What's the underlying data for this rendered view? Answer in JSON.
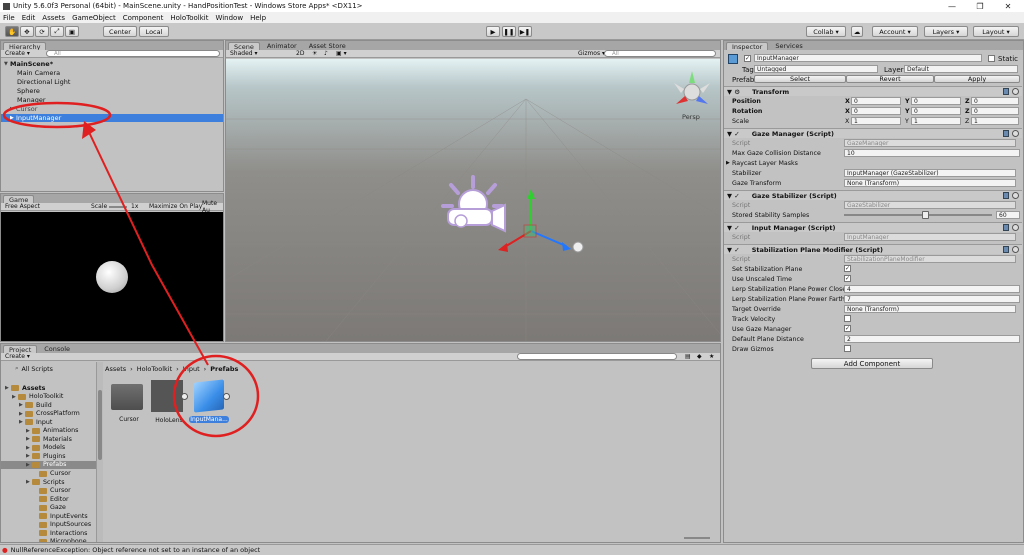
{
  "window": {
    "title": "Unity 5.6.0f3 Personal (64bit) - MainScene.unity - HandPositionTest - Windows Store Apps* <DX11>"
  },
  "menu": [
    "File",
    "Edit",
    "Assets",
    "GameObject",
    "Component",
    "HoloToolkit",
    "Window",
    "Help"
  ],
  "toolbar": {
    "center_label": "Center",
    "local_label": "Local",
    "collab_label": "Collab",
    "account_label": "Account",
    "layers_label": "Layers",
    "layout_label": "Layout"
  },
  "hierarchy": {
    "tab": "Hierarchy",
    "create": "Create",
    "search": "All",
    "scene": "MainScene*",
    "items": [
      "Main Camera",
      "Directional Light",
      "Sphere",
      "Manager",
      "Cursor",
      "InputManager"
    ]
  },
  "scene": {
    "tabs": [
      "Scene",
      "Animator",
      "Asset Store"
    ],
    "shading": "Shaded",
    "mode2d": "2D",
    "gizmos": "Gizmos",
    "search": "All",
    "persp": "Persp"
  },
  "game": {
    "tab": "Game",
    "aspect": "Free Aspect",
    "scale_label": "Scale",
    "scale_value": "1x",
    "maximize": "Maximize On Play",
    "mute": "Mute Au"
  },
  "inspector": {
    "tabs": [
      "Inspector",
      "Services"
    ],
    "object_name": "InputManager",
    "static_label": "Static",
    "tag_label": "Tag",
    "tag_value": "Untagged",
    "layer_label": "Layer",
    "layer_value": "Default",
    "prefab_label": "Prefab",
    "select": "Select",
    "revert": "Revert",
    "apply": "Apply",
    "transform": {
      "title": "Transform",
      "position": "Position",
      "rotation": "Rotation",
      "scale": "Scale",
      "pos": [
        "0",
        "0",
        "0"
      ],
      "rot": [
        "0",
        "0",
        "0"
      ],
      "scl": [
        "1",
        "1",
        "1"
      ],
      "axes": [
        "X",
        "Y",
        "Z"
      ]
    },
    "gaze_manager": {
      "title": "Gaze Manager (Script)",
      "script_label": "Script",
      "script_value": "GazeManager",
      "max_label": "Max Gaze Collision Distance",
      "max_value": "10",
      "raycast_label": "Raycast Layer Masks",
      "stabilizer_label": "Stabilizer",
      "stabilizer_value": "InputManager (GazeStabilizer)",
      "transform_label": "Gaze Transform",
      "transform_value": "None (Transform)"
    },
    "gaze_stabilizer": {
      "title": "Gaze Stabilizer (Script)",
      "script_label": "Script",
      "script_value": "GazeStabilizer",
      "samples_label": "Stored Stability Samples",
      "samples_value": "60",
      "samples_fraction": 0.55
    },
    "input_manager": {
      "title": "Input Manager (Script)",
      "script_label": "Script",
      "script_value": "InputManager"
    },
    "stab_plane": {
      "title": "Stabilization Plane Modifier (Script)",
      "script_label": "Script",
      "script_value": "StabilizationPlaneModifier",
      "set_label": "Set Stabilization Plane",
      "unscaled_label": "Use Unscaled Time",
      "closer_label": "Lerp Stabilization Plane Power Closer",
      "closer_value": "4",
      "farther_label": "Lerp Stabilization Plane Power Farthe",
      "farther_value": "7",
      "override_label": "Target Override",
      "override_value": "None (Transform)",
      "track_label": "Track Velocity",
      "usegaze_label": "Use Gaze Manager",
      "dist_label": "Default Plane Distance",
      "dist_value": "2",
      "gizmos_label": "Draw Gizmos"
    },
    "add_component": "Add Component"
  },
  "project": {
    "tabs": [
      "Project",
      "Console"
    ],
    "create": "Create",
    "all_scripts": "All Scripts",
    "breadcrumb": [
      "Assets",
      "HoloToolkit",
      "Input",
      "Prefabs"
    ],
    "tree": [
      {
        "label": "Assets",
        "indent": 0,
        "bold": true
      },
      {
        "label": "HoloToolkit",
        "indent": 1
      },
      {
        "label": "Build",
        "indent": 2
      },
      {
        "label": "CrossPlatform",
        "indent": 2
      },
      {
        "label": "Input",
        "indent": 2
      },
      {
        "label": "Animations",
        "indent": 3
      },
      {
        "label": "Materials",
        "indent": 3
      },
      {
        "label": "Models",
        "indent": 3
      },
      {
        "label": "Plugins",
        "indent": 3
      },
      {
        "label": "Prefabs",
        "indent": 3,
        "selected": true
      },
      {
        "label": "Cursor",
        "indent": 4
      },
      {
        "label": "Scripts",
        "indent": 3
      },
      {
        "label": "Cursor",
        "indent": 4
      },
      {
        "label": "Editor",
        "indent": 4
      },
      {
        "label": "Gaze",
        "indent": 4
      },
      {
        "label": "InputEvents",
        "indent": 4
      },
      {
        "label": "InputSources",
        "indent": 4
      },
      {
        "label": "Interactions",
        "indent": 4
      },
      {
        "label": "Microphone",
        "indent": 4
      }
    ],
    "assets": [
      "Cursor",
      "HoloLens",
      "InputMana..."
    ]
  },
  "status": {
    "error": "NullReferenceException: Object reference not set to an instance of an object"
  }
}
